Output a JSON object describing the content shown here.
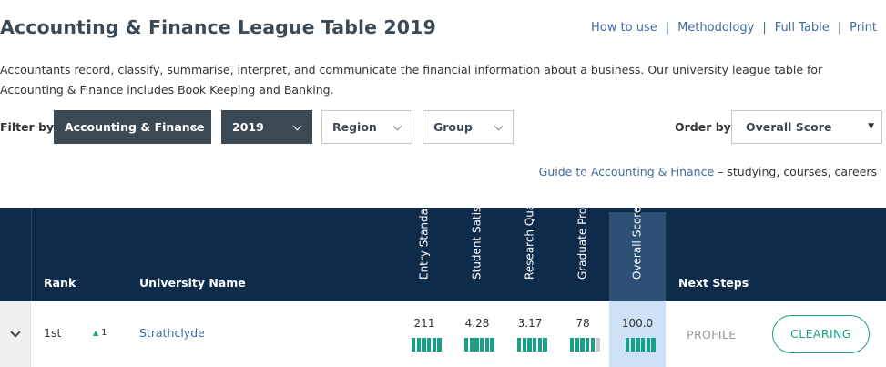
{
  "page": {
    "title": "Accounting & Finance League Table 2019",
    "intro": "Accountants record, classify, summarise, interpret, and communicate the financial information about a business. Our university league table for Accounting & Finance includes Book Keeping and Banking."
  },
  "top_links": {
    "how_to_use": "How to use",
    "methodology": "Methodology",
    "full_table": "Full Table",
    "print": "Print",
    "separator": "|"
  },
  "filters": {
    "label": "Filter by",
    "subject": "Accounting & Finance",
    "year": "2019",
    "region": "Region",
    "group": "Group",
    "order_label": "Order by",
    "order_value": "Overall Score"
  },
  "guide": {
    "link_text": "Guide to Accounting & Finance",
    "suffix": " – studying, courses, careers"
  },
  "table": {
    "headers": {
      "rank": "Rank",
      "university": "University Name",
      "entry": "Entry Standards",
      "satisfaction": "Student Satisfaction",
      "research": "Research Quality",
      "graduate": "Graduate Prospects",
      "overall": "Overall Score",
      "next_steps": "Next Steps"
    },
    "rows": [
      {
        "rank": "1st",
        "rank_change": "1",
        "university": "Strathclyde",
        "entry": "211",
        "satisfaction": "4.28",
        "research": "3.17",
        "graduate": "78",
        "overall": "100.0",
        "bars": {
          "entry": 1.0,
          "satisfaction": 1.0,
          "research": 1.0,
          "graduate": 0.83,
          "overall": 1.0
        },
        "profile": "PROFILE",
        "clearing": "CLEARING"
      }
    ]
  },
  "colors": {
    "header_bg": "#0e2b4a",
    "accent": "#16a085",
    "link": "#3f6b9b",
    "filter_dark": "#3b4954",
    "score_highlight": "#cfe1f5"
  }
}
